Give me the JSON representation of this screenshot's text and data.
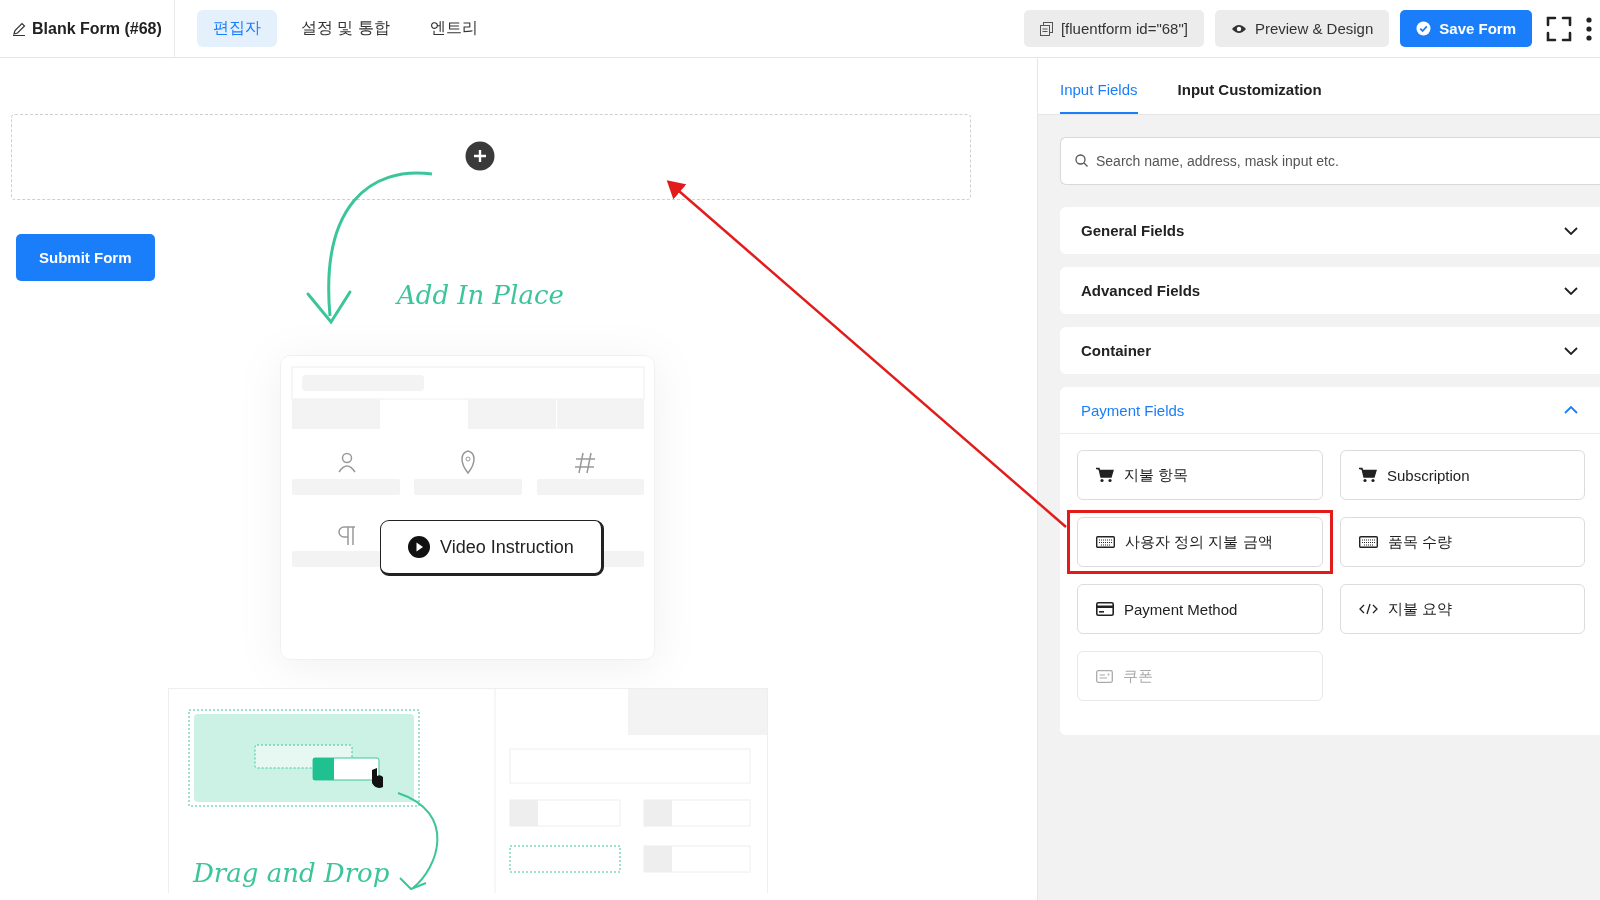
{
  "header": {
    "title": "Blank Form (#68)",
    "tabs": [
      {
        "label": "편집자",
        "selected": true
      },
      {
        "label": "설정 및 통합",
        "selected": false
      },
      {
        "label": "엔트리",
        "selected": false
      }
    ],
    "shortcode": "[fluentform id=\"68\"]",
    "preview_button": "Preview & Design",
    "save_button": "Save Form"
  },
  "canvas": {
    "submit_button": "Submit Form",
    "add_in_place": "Add In Place",
    "video_button": "Video Instruction",
    "drag_and_drop": "Drag and Drop"
  },
  "sidebar": {
    "tabs": [
      {
        "label": "Input Fields",
        "selected": true
      },
      {
        "label": "Input Customization",
        "selected": false
      }
    ],
    "search": {
      "placeholder": "Search name, address, mask input etc."
    },
    "sections": [
      {
        "title": "General Fields",
        "expanded": false
      },
      {
        "title": "Advanced Fields",
        "expanded": false
      },
      {
        "title": "Container",
        "expanded": false
      },
      {
        "title": "Payment Fields",
        "expanded": true,
        "items": [
          {
            "label": "지불 항목",
            "kind": "cart",
            "disabled": false,
            "highlighted": false
          },
          {
            "label": "Subscription",
            "kind": "cart",
            "disabled": false,
            "highlighted": false
          },
          {
            "label": "사용자 정의 지불 금액",
            "kind": "keyboard",
            "disabled": false,
            "highlighted": true
          },
          {
            "label": "품목 수량",
            "kind": "keyboard",
            "disabled": false,
            "highlighted": false
          },
          {
            "label": "Payment Method",
            "kind": "card",
            "disabled": false,
            "highlighted": false
          },
          {
            "label": "지불 요약",
            "kind": "code",
            "disabled": false,
            "highlighted": false
          },
          {
            "label": "쿠폰",
            "kind": "coupon",
            "disabled": true,
            "highlighted": false
          }
        ]
      }
    ]
  }
}
